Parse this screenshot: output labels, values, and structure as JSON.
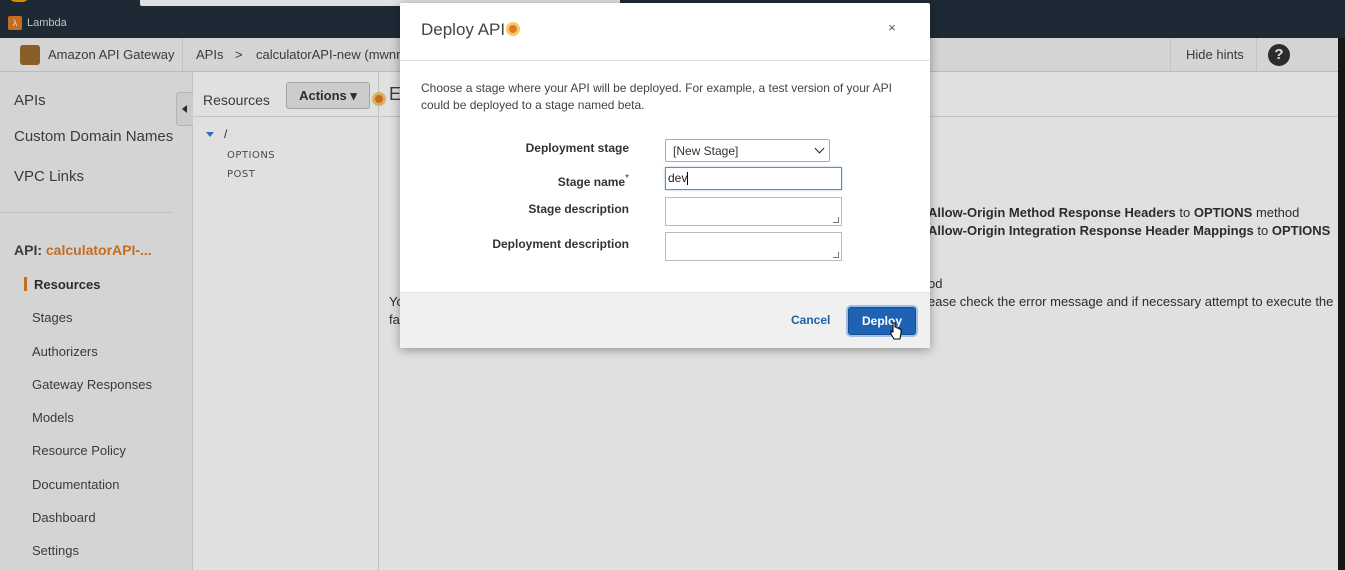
{
  "browser": {
    "bookmark_label": "Lambda"
  },
  "header": {
    "service_name": "Amazon API Gateway",
    "breadcrumb_apis": "APIs",
    "breadcrumb_sep": ">",
    "breadcrumb_api": "calculatorAPI-new (mwnm",
    "hide_hints": "Hide hints",
    "help_glyph": "?"
  },
  "sidebar": {
    "top_items": [
      {
        "label": "APIs"
      },
      {
        "label": "Custom Domain Names"
      },
      {
        "label": "VPC Links"
      }
    ],
    "api_prefix": "API:",
    "api_name": "calculatorAPI-...",
    "sub_items": [
      {
        "label": "Resources",
        "active": true
      },
      {
        "label": "Stages"
      },
      {
        "label": "Authorizers"
      },
      {
        "label": "Gateway Responses"
      },
      {
        "label": "Models"
      },
      {
        "label": "Resource Policy"
      },
      {
        "label": "Documentation"
      },
      {
        "label": "Dashboard"
      },
      {
        "label": "Settings"
      }
    ]
  },
  "resources": {
    "title": "Resources",
    "actions_label": "Actions ▾",
    "root": "/",
    "methods": [
      "OPTIONS",
      "POST"
    ]
  },
  "main": {
    "title_fragment": "E",
    "line1_bold": "Allow-Origin Method Response Headers",
    "line1_mid": " to ",
    "line1_bold2": "OPTIONS",
    "line1_end": " method",
    "line2_bold": "Allow-Origin Integration Response Header Mappings",
    "line2_mid": " to ",
    "line2_bold2": "OPTIONS",
    "line3": "od",
    "line4_left": "Yo",
    "line4_right": "ease check the error message and if necessary attempt to execute the",
    "line5_left": "fa"
  },
  "dialog": {
    "title": "Deploy API",
    "close": "×",
    "description": "Choose a stage where your API will be deployed. For example, a test version of your API could be deployed to a stage named beta.",
    "deployment_stage_label": "Deployment stage",
    "deployment_stage_value": "[New Stage]",
    "stage_name_label": "Stage name",
    "stage_name_required": "*",
    "stage_name_value": "dev",
    "stage_description_label": "Stage description",
    "deployment_description_label": "Deployment description",
    "cancel_label": "Cancel",
    "deploy_label": "Deploy"
  },
  "colors": {
    "aws_dark": "#232f3e",
    "accent_orange": "#e07b24",
    "primary_blue": "#1e63b3",
    "link_blue": "#1f5fa8"
  }
}
